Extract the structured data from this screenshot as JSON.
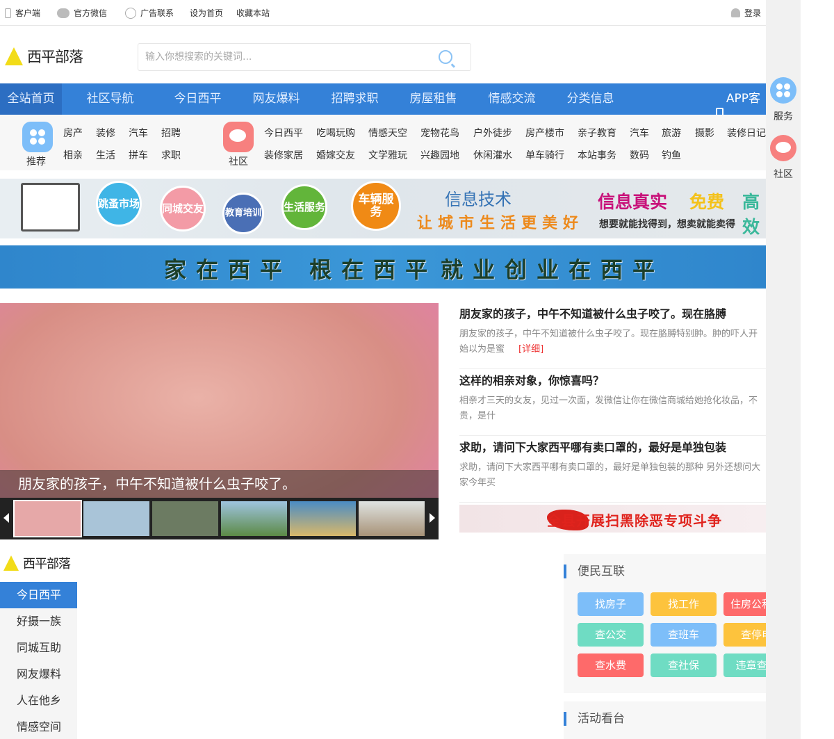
{
  "topbar": {
    "client": "客户端",
    "wechat": "官方微信",
    "ads": "广告联系",
    "homepage": "设为首页",
    "bookmark": "收藏本站",
    "login": "登录"
  },
  "logo": "西平部落",
  "search": {
    "placeholder": "输入你想搜索的关键词..."
  },
  "nav": {
    "items": [
      "全站首页",
      "社区导航",
      "今日西平",
      "网友爆料",
      "招聘求职",
      "房屋租售",
      "情感交流",
      "分类信息"
    ],
    "app": "APP客户端"
  },
  "cats": {
    "recommend_label": "推荐",
    "recommend": [
      "房产",
      "装修",
      "汽车",
      "招聘",
      "相亲",
      "生活",
      "拼车",
      "求职"
    ],
    "community_label": "社区",
    "community_row1": [
      "今日西平",
      "吃喝玩购",
      "情感天空",
      "宠物花鸟",
      "户外徒步",
      "房产楼市",
      "亲子教育",
      "汽车",
      "旅游",
      "摄影",
      "装修日记"
    ],
    "community_row2": [
      "装修家居",
      "婚嫁交友",
      "文学雅玩",
      "兴趣园地",
      "休闲灌水",
      "单车骑行",
      "本站事务",
      "数码",
      "钓鱼"
    ]
  },
  "banner1": {
    "circles": [
      "跳蚤市场",
      "同城交友",
      "教育培训",
      "生活服务",
      "车辆服务"
    ],
    "tech": "信息技术",
    "slogan": "让城市生活更美好",
    "tag1": "信息真实",
    "tag2": "免费",
    "tag3": "高效",
    "sub": "想要就能找得到，想卖就能卖得"
  },
  "banner2": {
    "left": "家在西平 根在西平",
    "right": "就业创业在西平"
  },
  "slider": {
    "caption": "朋友家的孩子，中午不知道被什么虫子咬了。"
  },
  "news": [
    {
      "title": "朋友家的孩子，中午不知道被什么虫子咬了。现在胳膊",
      "summary": "朋友家的孩子，中午不知道被什么虫子咬了。现在胳膊特别肿。肿的吓人开始以为是蜜",
      "more": "[详细]"
    },
    {
      "title": "这样的相亲对象，你惊喜吗？",
      "summary": "相亲才三天的女友，见过一次面，发微信让你在微信商城给她抢化妆品，不贵，是什"
    },
    {
      "title": "求助，请问下大家西平哪有卖口罩的，最好是单独包装",
      "summary": "求助，请问下大家西平哪有卖口罩的，最好是单独包装的那种 另外还想问大家今年买"
    }
  ],
  "banner3": "全县开展扫黑除恶专项斗争",
  "leftmenu": [
    "今日西平",
    "好摄一族",
    "同城互助",
    "网友爆料",
    "人在他乡",
    "情感空间"
  ],
  "service": {
    "title": "便民互联",
    "buttons": [
      "找房子",
      "找工作",
      "住房公积金",
      "查公交",
      "查班车",
      "查停电",
      "查水费",
      "查社保",
      "违章查询"
    ]
  },
  "activity": {
    "title": "活动看台"
  },
  "rside": {
    "service": "服务",
    "community": "社区"
  },
  "colors": {
    "nav": "#3481d8",
    "blue": "#7dbef9",
    "yellow": "#fdc33d",
    "red": "#fe6a6a",
    "green": "#6fdcc3"
  }
}
